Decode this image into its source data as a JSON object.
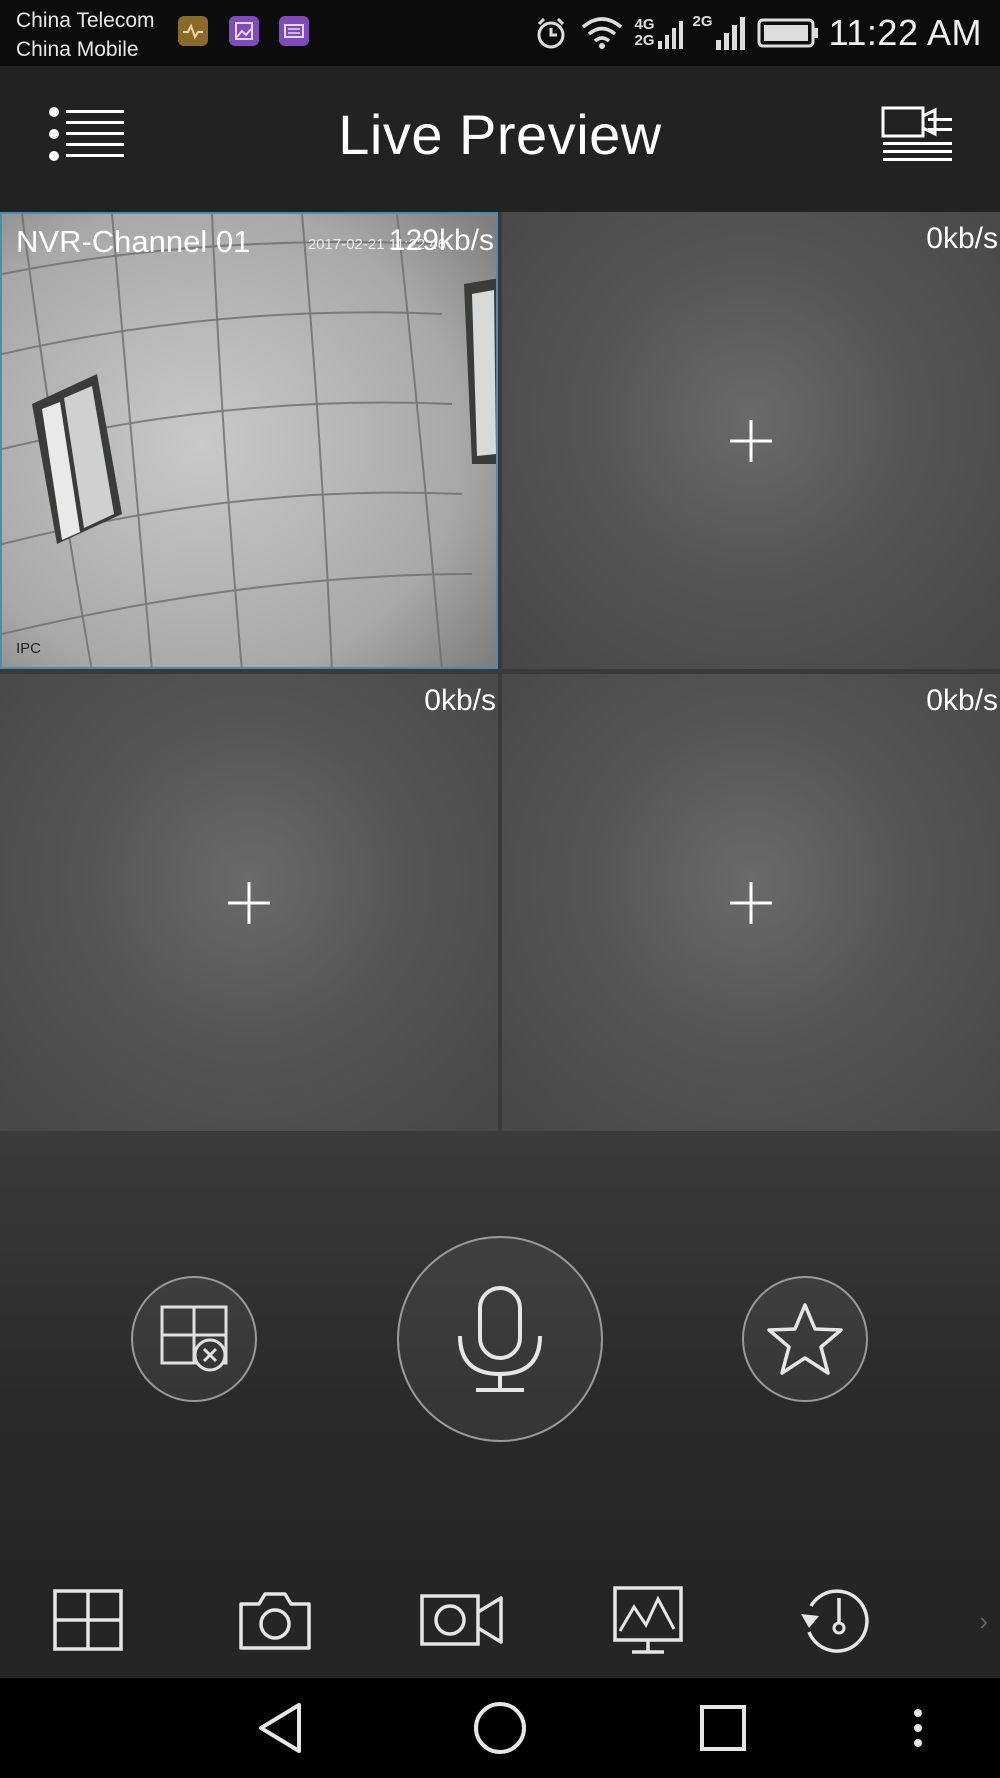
{
  "status_bar": {
    "carrier_1": "China Telecom",
    "carrier_2": "China Mobile",
    "network_1": "4G",
    "network_1b": "2G",
    "network_2": "2G",
    "time": "11:22 AM",
    "notification_icons": [
      "health-app-icon",
      "gallery-app-icon",
      "keyboard-app-icon"
    ]
  },
  "header": {
    "title": "Live Preview",
    "menu_icon": "list-menu-icon",
    "device_list_icon": "camera-list-icon"
  },
  "grid": {
    "cells": [
      {
        "channel": "NVR-Channel 01",
        "rate": "129kb/s",
        "osd_time": "2017-02-21 11:22:46",
        "osd_label": "IPC",
        "active": true
      },
      {
        "channel": "",
        "rate": "0kb/s",
        "active": false
      },
      {
        "channel": "",
        "rate": "0kb/s",
        "active": false
      },
      {
        "channel": "",
        "rate": "0kb/s",
        "active": false
      }
    ]
  },
  "controls": {
    "close_all": "close-all-windows-icon",
    "talk": "microphone-icon",
    "favorite": "star-icon"
  },
  "toolbar": {
    "items": [
      "split-screen-icon",
      "snapshot-icon",
      "record-icon",
      "image-adjust-icon",
      "playback-icon"
    ],
    "more": "›"
  },
  "colors": {
    "active_border": "#4a8db0",
    "background": "#1e1e1e"
  }
}
